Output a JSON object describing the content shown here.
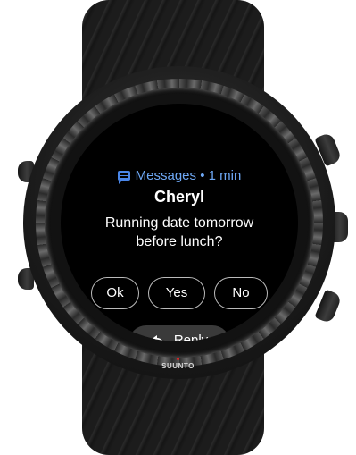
{
  "notification": {
    "app_name": "Messages",
    "separator": "•",
    "time_ago": "1 min",
    "sender": "Cheryl",
    "message_line1": "Running date tomorrow",
    "message_line2": "before lunch?"
  },
  "quick_replies": [
    {
      "label": "Ok"
    },
    {
      "label": "Yes"
    },
    {
      "label": "No"
    }
  ],
  "reply": {
    "label": "Reply",
    "icon": "reply-arrow-icon"
  },
  "device": {
    "brand": "SUUNTO"
  },
  "colors": {
    "app_accent": "#6ea8f5",
    "screen_background": "#000000",
    "text": "#ffffff",
    "reply_button_background": "#3a3a3a"
  },
  "icons": {
    "app": "message-bubble-icon",
    "reply": "reply-arrow-icon"
  }
}
